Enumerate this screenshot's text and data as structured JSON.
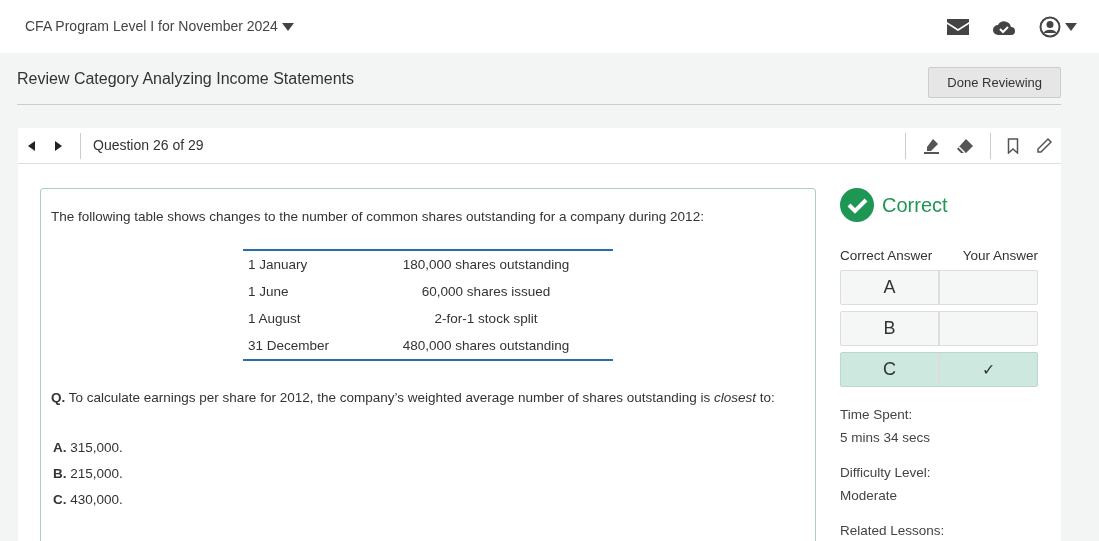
{
  "topbar": {
    "program": "CFA Program Level I for November 2024"
  },
  "header": {
    "title": "Review Category Analyzing Income Statements",
    "done_button": "Done Reviewing"
  },
  "question_bar": {
    "label": "Question 26 of 29"
  },
  "question": {
    "intro": "The following table shows changes to the number of common shares outstanding for a company during 2012:",
    "table": [
      {
        "date": "1 January",
        "event": "180,000 shares outstanding"
      },
      {
        "date": "1 June",
        "event": "60,000 shares issued"
      },
      {
        "date": "1 August",
        "event": "2-for-1 stock split"
      },
      {
        "date": "31 December",
        "event": "480,000 shares outstanding"
      }
    ],
    "stem": "**Q.** To calculate earnings per share for 2012, the company’s weighted average number of shares outstanding is *closest* to:",
    "options": [
      "**A.** 315,000.",
      "**B.** 215,000.",
      "**C.** 430,000."
    ]
  },
  "result": {
    "status": "Correct",
    "correct_answer_heading": "Correct Answer",
    "your_answer_heading": "Your Answer",
    "check_mark": "✓",
    "answers": [
      {
        "letter": "A",
        "correct": false,
        "selected": false
      },
      {
        "letter": "B",
        "correct": false,
        "selected": false
      },
      {
        "letter": "C",
        "correct": true,
        "selected": true
      }
    ],
    "details": [
      {
        "label": "Time Spent:",
        "value": "5 mins 34 secs"
      },
      {
        "label": "Difficulty Level:",
        "value": "Moderate"
      },
      {
        "label": "Related Lessons:"
      }
    ]
  }
}
